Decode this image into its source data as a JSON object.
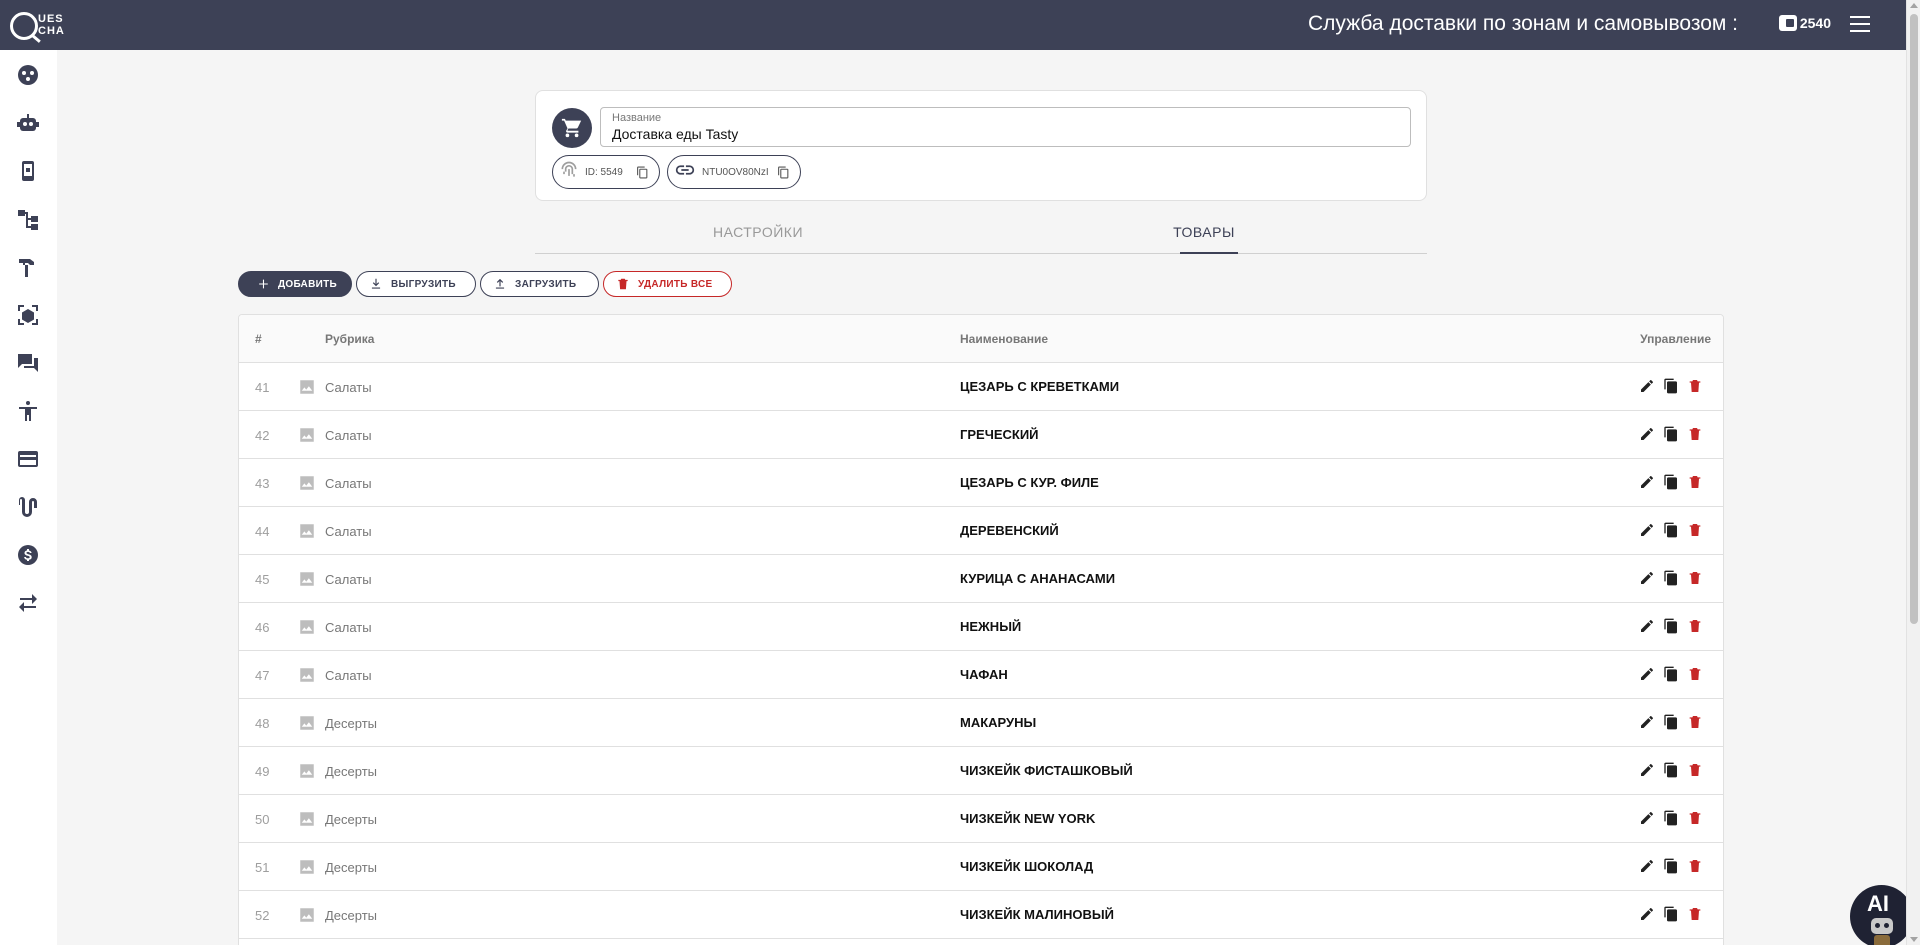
{
  "header": {
    "logo_line1": "UES",
    "logo_line2": "CHA",
    "title": "Служба доставки по зонам и самовывозом :",
    "balance": "2540"
  },
  "sidebar": {
    "items": [
      {
        "name": "groups-icon"
      },
      {
        "name": "robot-icon"
      },
      {
        "name": "mobile-app-icon"
      },
      {
        "name": "hierarchy-icon"
      },
      {
        "name": "hammer-icon"
      },
      {
        "name": "3d-box-icon"
      },
      {
        "name": "forum-icon"
      },
      {
        "name": "accessibility-icon"
      },
      {
        "name": "credit-card-icon"
      },
      {
        "name": "route-icon"
      },
      {
        "name": "dollar-icon"
      },
      {
        "name": "swap-icon"
      }
    ]
  },
  "card": {
    "name_label": "Название",
    "name_value": "Доставка еды Tasty",
    "id_chip": "ID: 5549",
    "link_chip": "NTU0OV80NzI"
  },
  "tabs": [
    {
      "label": "НАСТРОЙКИ",
      "active": false
    },
    {
      "label": "ТОВАРЫ",
      "active": true
    }
  ],
  "toolbar": {
    "add": "ДОБАВИТЬ",
    "unload": "ВЫГРУЗИТЬ",
    "load": "ЗАГРУЗИТЬ",
    "delete_all": "УДАЛИТЬ ВСЕ"
  },
  "table": {
    "headers": {
      "num": "#",
      "rubric": "Рубрика",
      "name": "Наименование",
      "control": "Управление"
    },
    "rows": [
      {
        "num": "41",
        "rubric": "Салаты",
        "name": "ЦЕЗАРЬ С КРЕВЕТКАМИ"
      },
      {
        "num": "42",
        "rubric": "Салаты",
        "name": "ГРЕЧЕСКИЙ"
      },
      {
        "num": "43",
        "rubric": "Салаты",
        "name": "ЦЕЗАРЬ С КУР. ФИЛЕ"
      },
      {
        "num": "44",
        "rubric": "Салаты",
        "name": "ДЕРЕВЕНСКИЙ"
      },
      {
        "num": "45",
        "rubric": "Салаты",
        "name": "КУРИЦА С АНАНАСАМИ"
      },
      {
        "num": "46",
        "rubric": "Салаты",
        "name": "НЕЖНЫЙ"
      },
      {
        "num": "47",
        "rubric": "Салаты",
        "name": "ЧАФАН"
      },
      {
        "num": "48",
        "rubric": "Десерты",
        "name": "МАКАРУНЫ"
      },
      {
        "num": "49",
        "rubric": "Десерты",
        "name": "ЧИЗКЕЙК ФИСТАШКОВЫЙ"
      },
      {
        "num": "50",
        "rubric": "Десерты",
        "name": "ЧИЗКЕЙК NEW YORK"
      },
      {
        "num": "51",
        "rubric": "Десерты",
        "name": "ЧИЗКЕЙК ШОКОЛАД"
      },
      {
        "num": "52",
        "rubric": "Десерты",
        "name": "ЧИЗКЕЙК МАЛИНОВЫЙ"
      }
    ]
  },
  "ai_button": {
    "label": "AI"
  },
  "colors": {
    "primary": "#3d4156",
    "danger": "#c62828",
    "background": "#f5f5f5"
  }
}
